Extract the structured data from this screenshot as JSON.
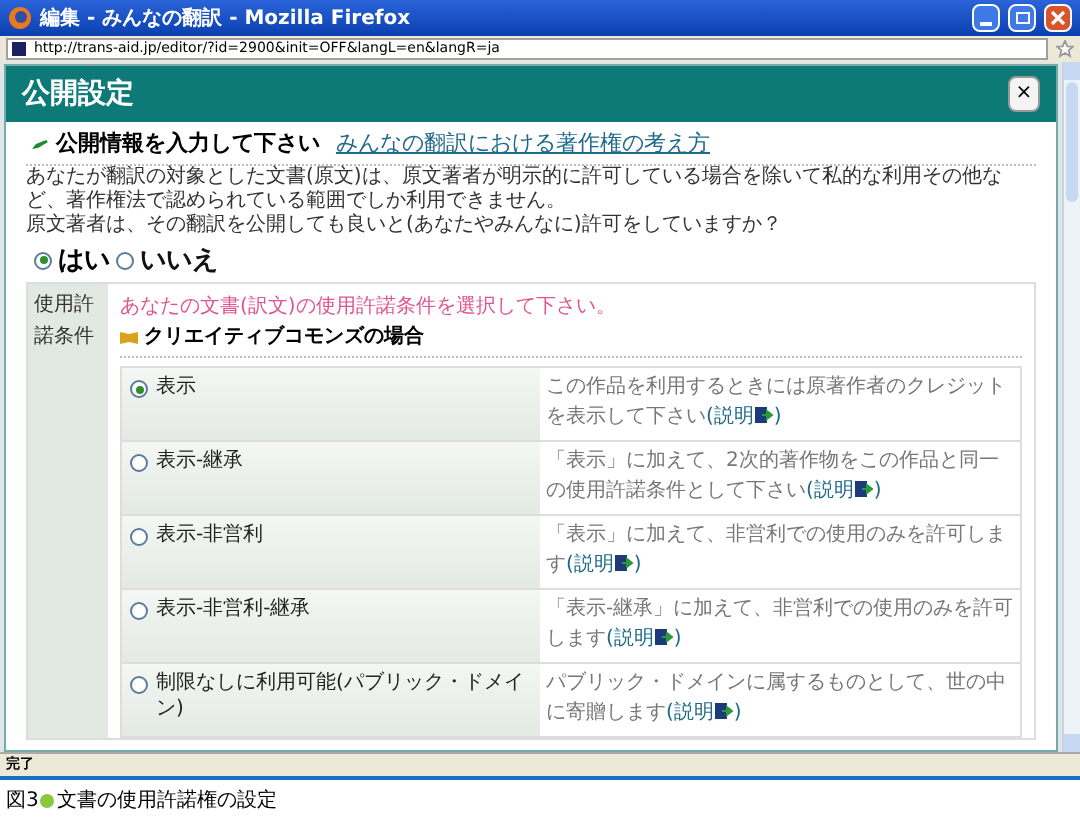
{
  "window": {
    "title": "編集 - みんなの翻訳 - Mozilla Firefox",
    "url": "http://trans-aid.jp/editor/?id=2900&init=OFF&langL=en&langR=ja"
  },
  "dialog": {
    "title": "公開設定",
    "close": "×",
    "heading": "公開情報を入力して下さい",
    "heading_link": "みんなの翻訳における著作権の考え方",
    "paragraphs": [
      "あなたが翻訳の対象とした文書(原文)は、原文著者が明示的に許可している場合を除いて私的な利用その他など、著作権法で認められている範囲でしか利用できません。",
      "原文著者は、その翻訳を公開しても良いと(あなたやみんなに)許可をしていますか？"
    ],
    "answers": [
      {
        "label": "はい",
        "selected": true
      },
      {
        "label": "いいえ",
        "selected": false
      }
    ],
    "license": {
      "label": "使用許諾条件",
      "instruction": "あなたの文書(訳文)の使用許諾条件を選択して下さい。",
      "group": "クリエイティブコモンズの場合",
      "options": [
        {
          "label": "表示",
          "selected": true,
          "description": "この作品を利用するときには原著作者のクレジットを表示して下さい",
          "link": "(説明",
          "link_end": ")"
        },
        {
          "label": "表示-継承",
          "selected": false,
          "description": "「表示」に加えて、2次的著作物をこの作品と同一の使用許諾条件として下さい",
          "link": "(説明",
          "link_end": ")"
        },
        {
          "label": "表示-非営利",
          "selected": false,
          "description": "「表示」に加えて、非営利での使用のみを許可します",
          "link": "(説明",
          "link_end": ")"
        },
        {
          "label": "表示-非営利-継承",
          "selected": false,
          "description": "「表示-継承」に加えて、非営利での使用のみを許可します",
          "link": "(説明",
          "link_end": ")"
        },
        {
          "label": "制限なしに利用可能(パブリック・ドメイン)",
          "selected": false,
          "description": "パブリック・ドメインに属するものとして、世の中に寄贈します",
          "link": "(説明",
          "link_end": ")"
        }
      ]
    }
  },
  "status_bar": "完了",
  "caption": {
    "prefix": "図3",
    "text": "文書の使用許諾権の設定"
  }
}
